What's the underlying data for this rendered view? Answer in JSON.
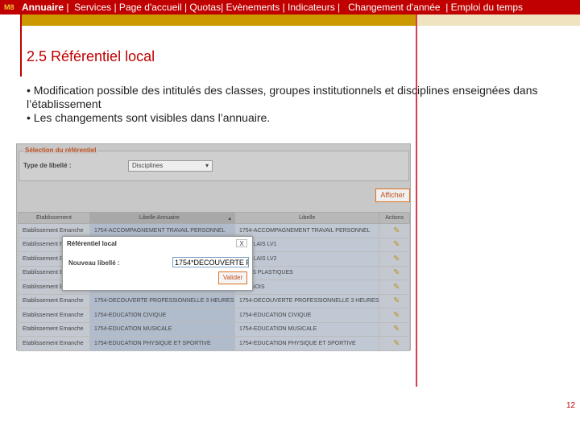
{
  "topbar": {
    "logo": "M8",
    "active": "Annuaire",
    "rest": " |  Services | Page d'accueil | Quotas| Evènements | Indicateurs |   Changement d'année  | Emploi du temps"
  },
  "slide": {
    "title": "2.5 Référentiel local",
    "bullets": [
      "• Modification possible des intitulés des classes, groupes institutionnels et disciplines enseignées dans l’établissement",
      "• Les changements sont visibles dans l’annuaire."
    ],
    "page_number": "12"
  },
  "screenshot": {
    "fieldset_legend": "Sélection du référentiel",
    "type_label": "Type de libellé :",
    "type_value": "Disciplines",
    "afficher": "Afficher",
    "columns": [
      "Etablissement",
      "Libelle Annuaire",
      "Libelle",
      "Actions"
    ],
    "rows": [
      [
        "Etablissement Emanche",
        "1754-ACCOMPAGNEMENT TRAVAIL PERSONNEL",
        "1754-ACCOMPAGNEMENT TRAVAIL PERSONNEL"
      ],
      [
        "Etablissement E",
        "",
        "-ANGLAIS LV1"
      ],
      [
        "Etablissement E",
        "",
        "-ANGLAIS LV2"
      ],
      [
        "Etablissement E",
        "",
        "-ARTS PLASTIQUES"
      ],
      [
        "Etablissement E",
        "",
        "-CHINOIS"
      ],
      [
        "Etablissement Emanche",
        "1754-DECOUVERTE PROFESSIONNELLE 3 HEURES",
        "1754-DECOUVERTE PROFESSIONNELLE 3 HEURES"
      ],
      [
        "Etablissement Emanche",
        "1754-EDUCATION CIVIQUE",
        "1754-EDUCATION CIVIQUE"
      ],
      [
        "Etablissement Emanche",
        "1754-EDUCATION MUSICALE",
        "1754-EDUCATION MUSICALE"
      ],
      [
        "Etablissement Emanche",
        "1754-EDUCATION PHYSIQUE ET SPORTIVE",
        "1754-EDUCATION PHYSIQUE ET SPORTIVE"
      ]
    ],
    "dialog": {
      "title": "Référentiel local",
      "close": "X",
      "label": "Nouveau libellé :",
      "value": "1754*DECOUVERTE P",
      "validate": "Valider"
    }
  },
  "colors": {
    "accent": "#c00000",
    "gold": "#cc9900"
  }
}
